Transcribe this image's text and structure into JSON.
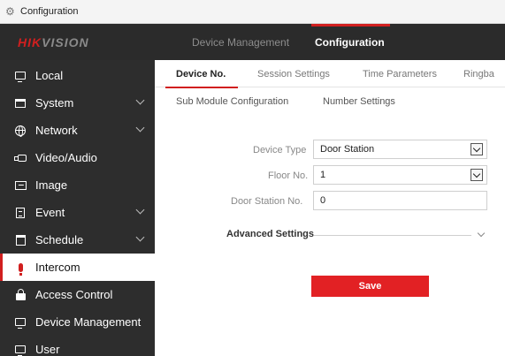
{
  "window": {
    "title": "Configuration"
  },
  "header": {
    "logo": {
      "red": "HIK",
      "gray": "VISION"
    },
    "nav": [
      "Device Management",
      "Configuration"
    ],
    "active_nav": "Configuration"
  },
  "sidebar": {
    "items": [
      {
        "label": "Local",
        "icon": "monitor-icon",
        "expandable": false
      },
      {
        "label": "System",
        "icon": "window-icon",
        "expandable": true
      },
      {
        "label": "Network",
        "icon": "globe-icon",
        "expandable": true
      },
      {
        "label": "Video/Audio",
        "icon": "camera-icon",
        "expandable": false
      },
      {
        "label": "Image",
        "icon": "image-icon",
        "expandable": false
      },
      {
        "label": "Event",
        "icon": "document-icon",
        "expandable": true
      },
      {
        "label": "Schedule",
        "icon": "calendar-icon",
        "expandable": true
      },
      {
        "label": "Intercom",
        "icon": "microphone-icon",
        "expandable": false,
        "active": true
      },
      {
        "label": "Access Control",
        "icon": "lock-icon",
        "expandable": false
      },
      {
        "label": "Device Management",
        "icon": "monitor-icon",
        "expandable": false
      },
      {
        "label": "User",
        "icon": "monitor-icon",
        "expandable": false
      }
    ]
  },
  "tabs": [
    {
      "label": "Device No.",
      "active": true
    },
    {
      "label": "Session Settings"
    },
    {
      "label": "Time Parameters"
    },
    {
      "label": "Ringba"
    }
  ],
  "subtabs": [
    "Sub Module Configuration",
    "Number Settings"
  ],
  "form": {
    "device_type": {
      "label": "Device Type",
      "value": "Door Station"
    },
    "floor_no": {
      "label": "Floor No.",
      "value": "1"
    },
    "door_station_no": {
      "label": "Door Station No.",
      "value": "0"
    }
  },
  "advanced": {
    "label": "Advanced Settings"
  },
  "save_label": "Save",
  "colors": {
    "accent": "#e22124",
    "header_bg": "#2b2b2b",
    "sidebar_bg": "#2d2d2d"
  }
}
